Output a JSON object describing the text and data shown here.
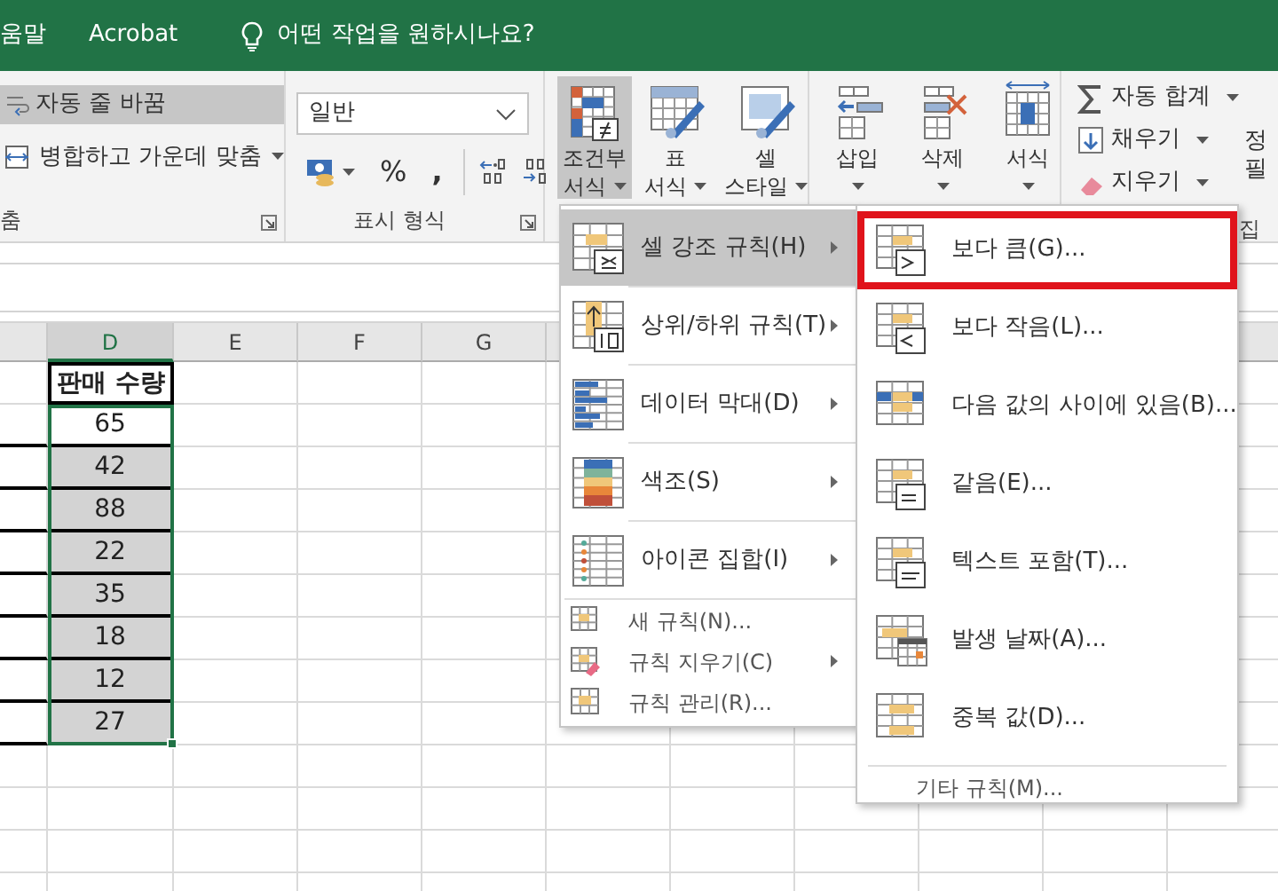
{
  "menu_bar": {
    "items": [
      "움말",
      "Acrobat"
    ],
    "tell_me": "어떤 작업을 원하시나요?"
  },
  "ribbon": {
    "alignment": {
      "wrap_text": {
        "label": "자동 줄 바꿈",
        "on": true
      },
      "merge": "병합하고 가운데 맞춤",
      "label": "춤"
    },
    "number": {
      "format": "일반",
      "percent": "%",
      "comma": ",",
      "label": "표시 형식"
    },
    "styles": [
      {
        "lines": [
          "조건부",
          "서식"
        ],
        "selected": true
      },
      {
        "lines": [
          "표",
          "서식"
        ],
        "selected": false
      },
      {
        "lines": [
          "셀",
          "스타일"
        ],
        "selected": false
      }
    ],
    "cells": [
      {
        "label": "삽입"
      },
      {
        "label": "삭제"
      },
      {
        "label": "서식"
      }
    ],
    "editing": {
      "items": [
        "자동 합계",
        "채우기",
        "지우기"
      ],
      "sort_lines": [
        "정",
        "필"
      ],
      "label": "집"
    }
  },
  "sheet": {
    "columns": [
      {
        "label": "D",
        "selected": true
      },
      {
        "label": "E",
        "selected": false
      },
      {
        "label": "F",
        "selected": false
      },
      {
        "label": "G",
        "selected": false
      }
    ],
    "header": "판매 수량",
    "values": [
      {
        "value": "65",
        "active": true
      },
      {
        "value": "42",
        "active": false
      },
      {
        "value": "88",
        "active": false
      },
      {
        "value": "22",
        "active": false
      },
      {
        "value": "35",
        "active": false
      },
      {
        "value": "18",
        "active": false
      },
      {
        "value": "12",
        "active": false
      },
      {
        "value": "27",
        "active": false
      }
    ]
  },
  "menu": {
    "items": [
      {
        "kind": "large",
        "label": "셀 강조 규칙(H)",
        "submenu": true,
        "selected": true
      },
      {
        "kind": "large",
        "label": "상위/하위 규칙(T)",
        "submenu": true,
        "selected": false
      },
      {
        "kind": "large",
        "label": "데이터 막대(D)",
        "submenu": true,
        "selected": false
      },
      {
        "kind": "large",
        "label": "색조(S)",
        "submenu": true,
        "selected": false
      },
      {
        "kind": "large",
        "label": "아이콘 집합(I)",
        "submenu": true,
        "selected": false
      },
      {
        "kind": "small",
        "label": "새 규칙(N)...",
        "submenu": false,
        "selected": false
      },
      {
        "kind": "small",
        "label": "규칙 지우기(C)",
        "submenu": true,
        "selected": false
      },
      {
        "kind": "small",
        "label": "규칙 관리(R)...",
        "submenu": false,
        "selected": false
      }
    ]
  },
  "submenu": {
    "items": [
      {
        "label": "보다 큼(G)...",
        "selected": true
      },
      {
        "label": "보다 작음(L)...",
        "selected": false
      },
      {
        "label": "다음 값의 사이에 있음(B)...",
        "selected": false
      },
      {
        "label": "같음(E)...",
        "selected": false
      },
      {
        "label": "텍스트 포함(T)...",
        "selected": false
      },
      {
        "label": "발생 날짜(A)...",
        "selected": false
      },
      {
        "label": "중복 값(D)...",
        "selected": false
      }
    ],
    "footer": "기타 규칙(M)..."
  }
}
